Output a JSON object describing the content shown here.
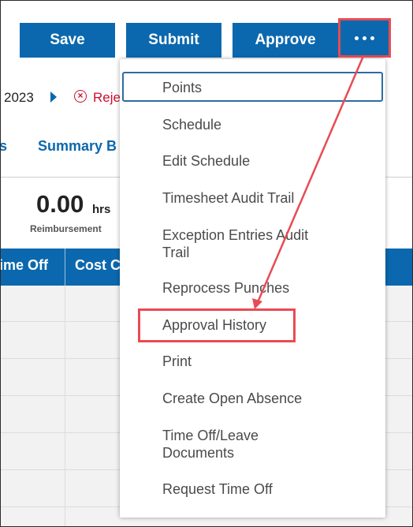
{
  "toolbar": {
    "save_label": "Save",
    "submit_label": "Submit",
    "approve_label": "Approve",
    "more_icon": "more-dots-icon"
  },
  "breadcrumb": {
    "period_end": "2023",
    "status": "Reje"
  },
  "tabs": {
    "left_partial": "s",
    "summary_partial": "Summary B"
  },
  "totals": {
    "value": "0.00",
    "unit": "hrs",
    "label": "Reimbursement"
  },
  "grid": {
    "headers": [
      "ime Off",
      "Cost C"
    ]
  },
  "menu": {
    "items": [
      "Points",
      "Schedule",
      "Edit Schedule",
      "Timesheet Audit Trail",
      "Exception Entries Audit Trail",
      "Reprocess Punches",
      "Approval History",
      "Print",
      "Create Open Absence",
      "Time Off/Leave Documents",
      "Request Time Off"
    ]
  },
  "colors": {
    "primary": "#0b68ae",
    "annotation": "#e84b54",
    "rejected": "#c8102e"
  }
}
